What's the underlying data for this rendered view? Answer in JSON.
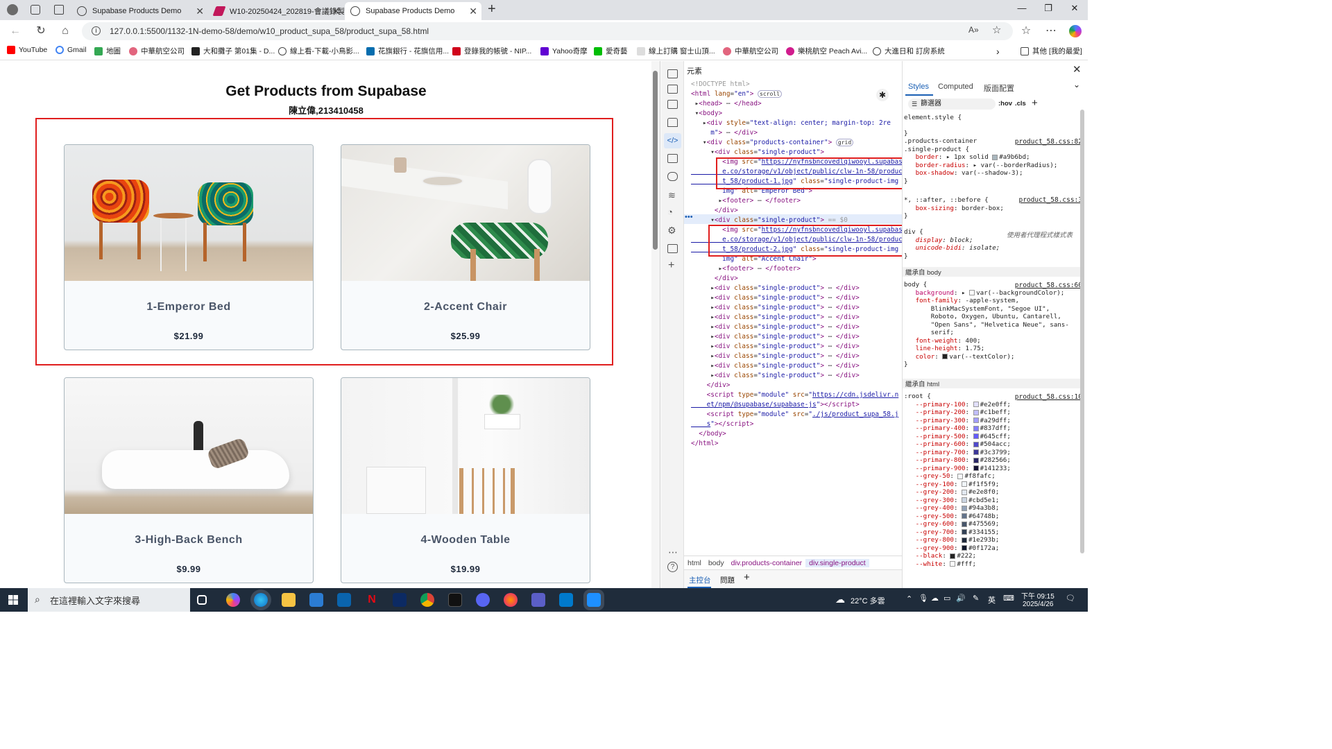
{
  "browser": {
    "tabs": [
      {
        "title": "Supabase Products Demo",
        "active": false
      },
      {
        "title": "W10-20250424_202819-會議錄製.r",
        "active": false
      },
      {
        "title": "Supabase Products Demo",
        "active": true
      }
    ],
    "new_tab": "+",
    "url": "127.0.0.1:5500/1132-1N-demo-58/demo/w10_product_supa_58/product_supa_58.html",
    "bookmarks": [
      "YouTube",
      "Gmail",
      "地圖",
      "中華航空公司",
      "大和攤子 第01集 - D...",
      "線上看-下載-小鳥影...",
      "花旗銀行 - 花旗信用...",
      "登錄我的帳號 - NIP...",
      "Yahoo奇摩",
      "愛奇藝",
      "線上訂購 窗士山頂...",
      "中華航空公司",
      "樂桃航空 Peach Avi...",
      "大進日和 訂房系統"
    ],
    "bookmarks_other": "其他 [我的最愛]"
  },
  "page": {
    "title": "Get Products from Supabase",
    "subtitle": "陳立偉,213410458",
    "products": [
      {
        "name": "1-Emperor Bed",
        "price": "$21.99",
        "image": "orange-blue-chairs"
      },
      {
        "name": "2-Accent Chair",
        "price": "$25.99",
        "image": "white-chair-table"
      },
      {
        "name": "3-High-Back Bench",
        "price": "$9.99",
        "image": "white-chaise"
      },
      {
        "name": "4-Wooden Table",
        "price": "$19.99",
        "image": "white-room-dresser"
      }
    ]
  },
  "devtools": {
    "panel_title": "元素",
    "breadcrumbs": [
      "html",
      "body",
      "div.products-container",
      "div.single-product"
    ],
    "drawer_tabs": [
      "主控台",
      "問題"
    ],
    "styles_tabs": [
      "Styles",
      "Computed",
      "版面配置"
    ],
    "filter_placeholder": "篩選器",
    "filter_hov": ":hov",
    "filter_cls": ".cls",
    "inherited_body": "繼承自 body",
    "inherited_html": "繼承自 html",
    "src_product_css_82": "product_58.css:82",
    "src_product_css_3": "product_58.css:3",
    "src_product_css_60": "product_58.css:60",
    "src_product_css_10": "product_58.css:10",
    "user_agent": "使用者代理程式樣式表"
  },
  "taskbar": {
    "search_placeholder": "在這裡輸入文字來搜尋",
    "weather": "22°C 多雲",
    "ime": "英",
    "time": "下午 09:15",
    "date": "2025/4/26"
  },
  "colors": {
    "highlight_red": "#e01e1e",
    "card_border": "#a9b6bd",
    "card_bg": "#f8fafc",
    "product_name": "#4a5568",
    "taskbar": "#1f2c3b"
  }
}
